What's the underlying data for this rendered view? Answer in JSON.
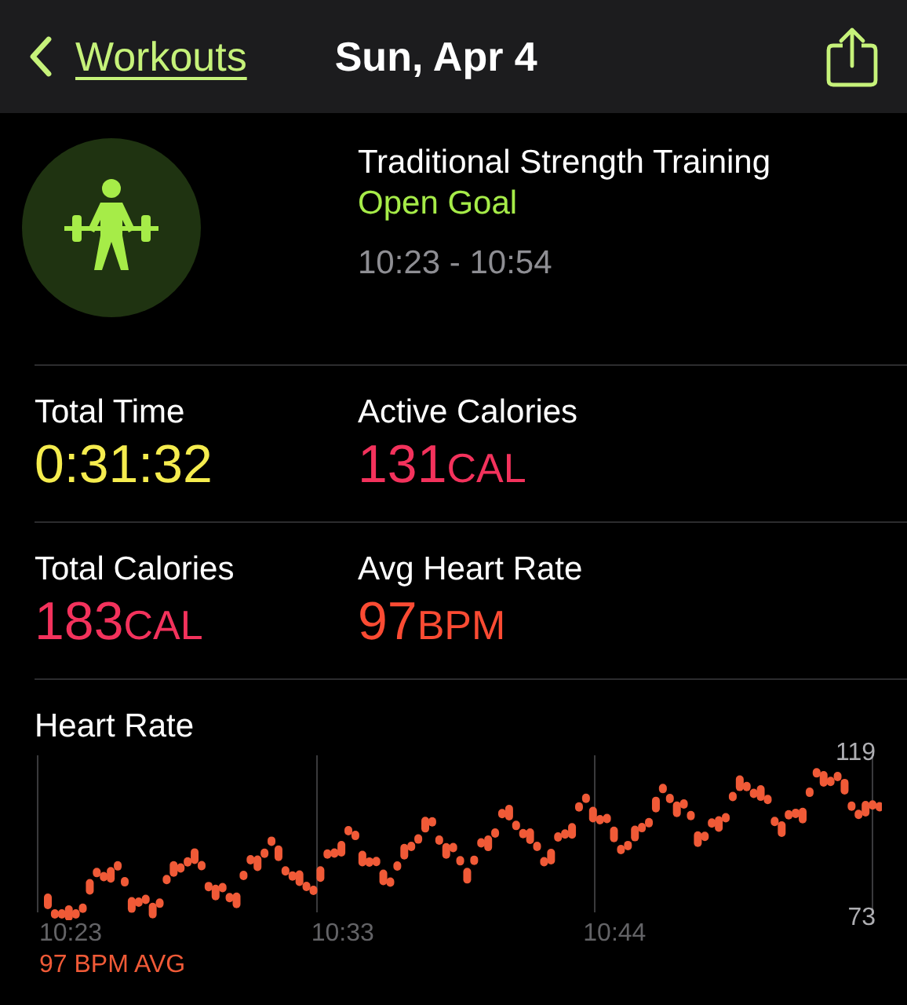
{
  "nav": {
    "back_label": "Workouts",
    "title": "Sun, Apr 4"
  },
  "workout": {
    "name": "Traditional Strength Training",
    "goal": "Open Goal",
    "time_range": "10:23 - 10:54"
  },
  "metrics": [
    {
      "label": "Total Time",
      "value": "0:31:32",
      "color": "#f5ec4e"
    },
    {
      "label": "Active Calories",
      "value": "131",
      "unit": "CAL",
      "color": "#f3325c"
    },
    {
      "label": "Total Calories",
      "value": "183",
      "unit": "CAL",
      "color": "#f3325c"
    },
    {
      "label": "Avg Heart Rate",
      "value": "97",
      "unit": "BPM",
      "color": "#fb4b33"
    }
  ],
  "heart_rate": {
    "title": "Heart Rate",
    "max_label": "119",
    "min_label": "73",
    "time_labels": [
      "10:23",
      "10:33",
      "10:44"
    ],
    "average": "97 BPM AVG"
  }
}
